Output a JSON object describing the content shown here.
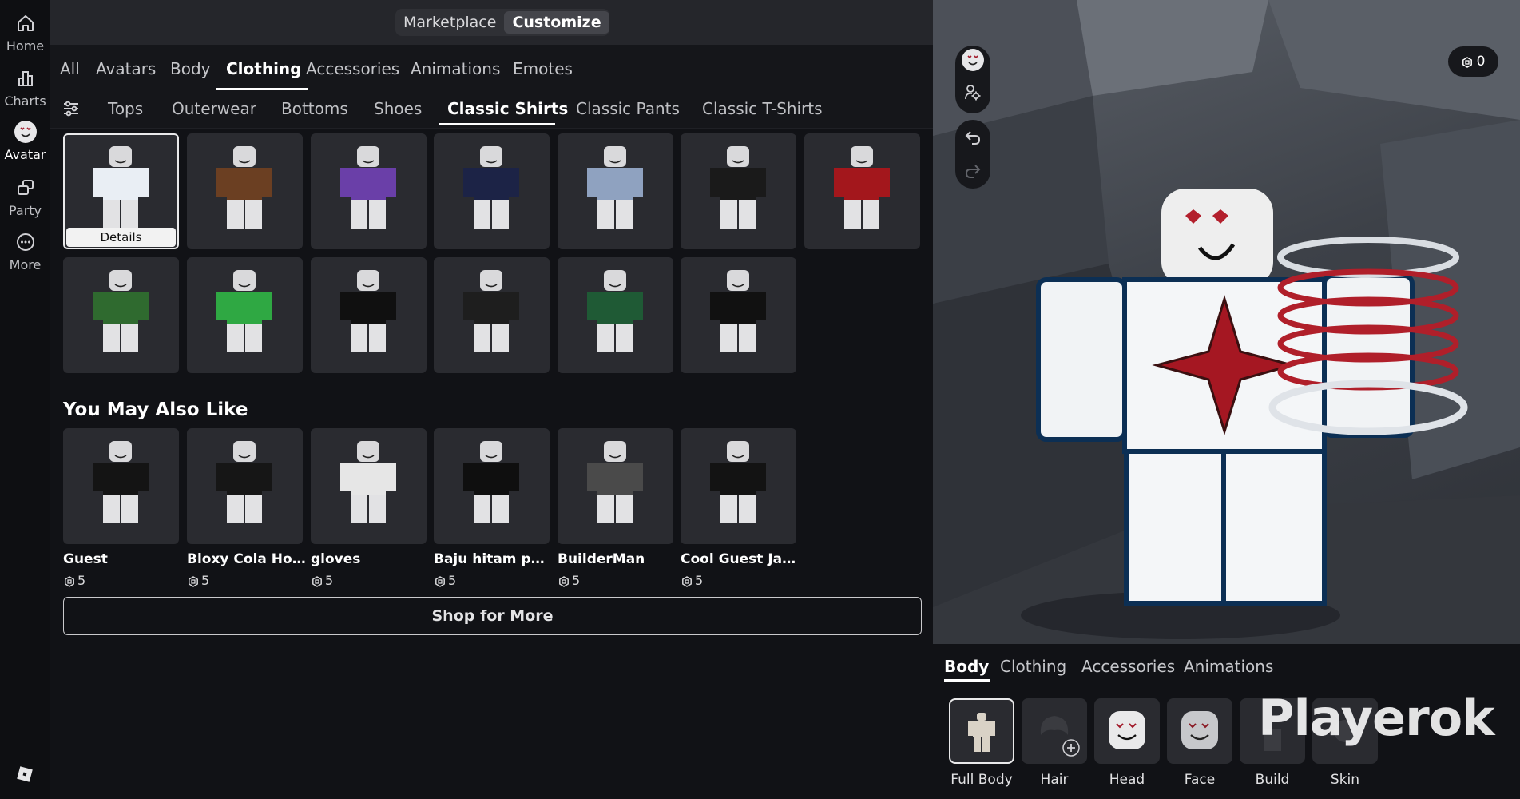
{
  "nav": {
    "items": [
      {
        "label": "Home",
        "icon": "home-icon"
      },
      {
        "label": "Charts",
        "icon": "bar-chart-icon"
      },
      {
        "label": "Avatar",
        "icon": "avatar-icon"
      },
      {
        "label": "Party",
        "icon": "party-icon"
      },
      {
        "label": "More",
        "icon": "more-icon"
      }
    ],
    "active": "Avatar"
  },
  "mode_switch": {
    "marketplace": "Marketplace",
    "customize": "Customize",
    "active": "Customize"
  },
  "category_tabs": [
    "All",
    "Avatars",
    "Body",
    "Clothing",
    "Accessories",
    "Animations",
    "Emotes"
  ],
  "category_active": "Clothing",
  "subcategory_tabs": [
    "Tops",
    "Outerwear",
    "Bottoms",
    "Shoes",
    "Classic Shirts",
    "Classic Pants",
    "Classic T-Shirts"
  ],
  "subcategory_active": "Classic Shirts",
  "owned_items": {
    "details_label": "Details",
    "colors": [
      "#e9eef4",
      "#6b3f22",
      "#6a3fa8",
      "#1c2346",
      "#8fa2c0",
      "#1a1a1a",
      "#a3171c",
      "#2f6a2f",
      "#2fa843",
      "#101010",
      "#1e1e1e",
      "#1f5a35",
      "#111111"
    ]
  },
  "recommendations": {
    "title": "You May Also Like",
    "items": [
      {
        "name": "Guest",
        "price": "5",
        "color": "#141414"
      },
      {
        "name": "Bloxy Cola Hoo...",
        "price": "5",
        "color": "#161616"
      },
      {
        "name": "gloves",
        "price": "5",
        "color": "#e6e6e6"
      },
      {
        "name": "Baju hitam polos",
        "price": "5",
        "color": "#0f0f0f"
      },
      {
        "name": "BuilderMan",
        "price": "5",
        "color": "#4a4a4a"
      },
      {
        "name": "Cool Guest Jacket",
        "price": "5",
        "color": "#131313"
      }
    ],
    "shop_label": "Shop for More"
  },
  "viewport": {
    "robux_balance": "0"
  },
  "bottom_tabs": [
    "Body",
    "Clothing",
    "Accessories",
    "Animations"
  ],
  "bottom_active": "Body",
  "body_parts": [
    "Full Body",
    "Hair",
    "Head",
    "Face",
    "Build",
    "Skin"
  ],
  "watermark": "Playerok"
}
